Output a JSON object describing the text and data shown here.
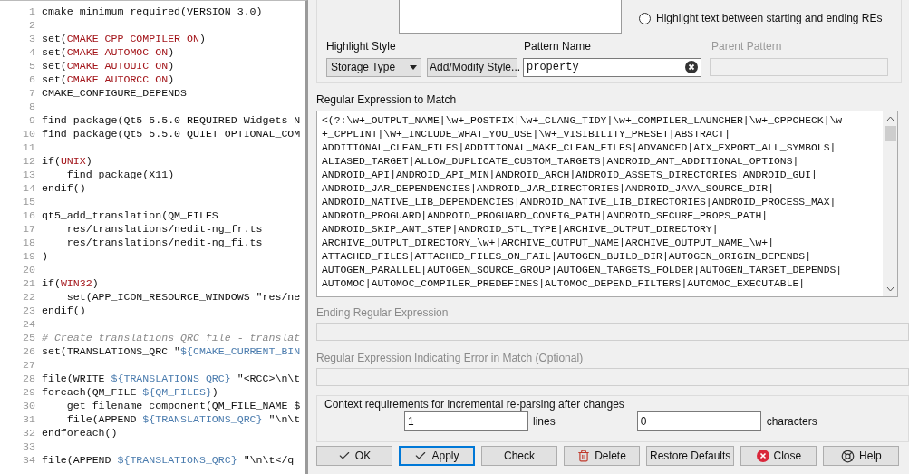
{
  "editor": {
    "lines": [
      {
        "number": "1",
        "segments": [
          {
            "kind": "plain",
            "text": "cmake minimum required(VERSION 3.0)"
          }
        ]
      },
      {
        "number": "2"
      },
      {
        "number": "3",
        "segments": [
          {
            "kind": "plain",
            "text": "set("
          },
          {
            "kind": "var",
            "text": "CMAKE CPP COMPILER ON"
          },
          {
            "kind": "plain",
            "text": ")"
          }
        ]
      },
      {
        "number": "4",
        "segments": [
          {
            "kind": "plain",
            "text": "set("
          },
          {
            "kind": "var",
            "text": "CMAKE AUTOMOC ON"
          },
          {
            "kind": "plain",
            "text": ")"
          }
        ]
      },
      {
        "number": "5",
        "segments": [
          {
            "kind": "plain",
            "text": "set("
          },
          {
            "kind": "var",
            "text": "CMAKE AUTOUIC ON"
          },
          {
            "kind": "plain",
            "text": ")"
          }
        ]
      },
      {
        "number": "6",
        "segments": [
          {
            "kind": "plain",
            "text": "set("
          },
          {
            "kind": "var",
            "text": "CMAKE AUTORCC ON"
          },
          {
            "kind": "plain",
            "text": ")"
          }
        ]
      },
      {
        "number": "7",
        "segments": [
          {
            "kind": "plain",
            "text": "CMAKE_CONFIGURE_DEPENDS"
          }
        ]
      },
      {
        "number": "8"
      },
      {
        "number": "9",
        "segments": [
          {
            "kind": "plain",
            "text": "find package(Qt5 5.5.0 REQUIRED Widgets N"
          }
        ]
      },
      {
        "number": "10",
        "segments": [
          {
            "kind": "plain",
            "text": "find package(Qt5 5.5.0 QUIET OPTIONAL_COM"
          }
        ]
      },
      {
        "number": "11"
      },
      {
        "number": "12",
        "segments": [
          {
            "kind": "plain",
            "text": "if("
          },
          {
            "kind": "var",
            "text": "UNIX"
          },
          {
            "kind": "plain",
            "text": ")"
          }
        ]
      },
      {
        "number": "13",
        "segments": [
          {
            "kind": "plain",
            "text": "    find package(X11)"
          }
        ]
      },
      {
        "number": "14",
        "segments": [
          {
            "kind": "plain",
            "text": "endif()"
          }
        ]
      },
      {
        "number": "15"
      },
      {
        "number": "16",
        "segments": [
          {
            "kind": "plain",
            "text": "qt5_add_translation(QM_FILES"
          }
        ]
      },
      {
        "number": "17",
        "segments": [
          {
            "kind": "plain",
            "text": "    res/translations/nedit-ng_fr.ts"
          }
        ]
      },
      {
        "number": "18",
        "segments": [
          {
            "kind": "plain",
            "text": "    res/translations/nedit-ng_fi.ts"
          }
        ]
      },
      {
        "number": "19",
        "segments": [
          {
            "kind": "plain",
            "text": ")"
          }
        ]
      },
      {
        "number": "20"
      },
      {
        "number": "21",
        "segments": [
          {
            "kind": "plain",
            "text": "if("
          },
          {
            "kind": "var",
            "text": "WIN32"
          },
          {
            "kind": "plain",
            "text": ")"
          }
        ]
      },
      {
        "number": "22",
        "segments": [
          {
            "kind": "plain",
            "text": "    set(APP_ICON_RESOURCE_WINDOWS \"res/ne"
          }
        ]
      },
      {
        "number": "23",
        "segments": [
          {
            "kind": "plain",
            "text": "endif()"
          }
        ]
      },
      {
        "number": "24"
      },
      {
        "number": "25",
        "segments": [
          {
            "kind": "comment",
            "text": "# Create translations QRC file - translat"
          }
        ]
      },
      {
        "number": "26",
        "segments": [
          {
            "kind": "plain",
            "text": "set(TRANSLATIONS_QRC \""
          },
          {
            "kind": "subst",
            "text": "${CMAKE_CURRENT_BIN"
          }
        ]
      },
      {
        "number": "27"
      },
      {
        "number": "28",
        "segments": [
          {
            "kind": "plain",
            "text": "file(WRITE "
          },
          {
            "kind": "subst",
            "text": "${TRANSLATIONS_QRC}"
          },
          {
            "kind": "plain",
            "text": " \"<RCC>\\n\\t"
          }
        ]
      },
      {
        "number": "29",
        "segments": [
          {
            "kind": "plain",
            "text": "foreach(QM_FILE "
          },
          {
            "kind": "subst",
            "text": "${QM_FILES}"
          },
          {
            "kind": "plain",
            "text": ")"
          }
        ]
      },
      {
        "number": "30",
        "segments": [
          {
            "kind": "plain",
            "text": "    get filename component(QM_FILE_NAME $"
          }
        ]
      },
      {
        "number": "31",
        "segments": [
          {
            "kind": "plain",
            "text": "    file(APPEND "
          },
          {
            "kind": "subst",
            "text": "${TRANSLATIONS_QRC}"
          },
          {
            "kind": "plain",
            "text": " \"\\n\\t"
          }
        ]
      },
      {
        "number": "32",
        "segments": [
          {
            "kind": "plain",
            "text": "endforeach()"
          }
        ]
      },
      {
        "number": "33"
      },
      {
        "number": "34",
        "segments": [
          {
            "kind": "plain",
            "text": "file(APPEND "
          },
          {
            "kind": "subst",
            "text": "${TRANSLATIONS_QRC}"
          },
          {
            "kind": "plain",
            "text": " \"\\n\\t</q"
          }
        ]
      }
    ]
  },
  "dialog": {
    "radio": {
      "label": "Highlight text between starting and ending REs",
      "selected": false
    },
    "highlight_style": {
      "label": "Highlight Style",
      "value": "Storage Type"
    },
    "add_modify_button": "Add/Modify Style...",
    "pattern_name": {
      "label": "Pattern Name",
      "value": "property"
    },
    "parent_pattern": {
      "label": "Parent Pattern",
      "disabled": true
    },
    "regex_to_match": {
      "label": "Regular Expression to Match",
      "lines": [
        "<(?:\\w+_OUTPUT_NAME|\\w+_POSTFIX|\\w+_CLANG_TIDY|\\w+_COMPILER_LAUNCHER|\\w+_CPPCHECK|\\w",
        "+_CPPLINT|\\w+_INCLUDE_WHAT_YOU_USE|\\w+_VISIBILITY_PRESET|ABSTRACT|",
        "ADDITIONAL_CLEAN_FILES|ADDITIONAL_MAKE_CLEAN_FILES|ADVANCED|AIX_EXPORT_ALL_SYMBOLS|",
        "ALIASED_TARGET|ALLOW_DUPLICATE_CUSTOM_TARGETS|ANDROID_ANT_ADDITIONAL_OPTIONS|",
        "ANDROID_API|ANDROID_API_MIN|ANDROID_ARCH|ANDROID_ASSETS_DIRECTORIES|ANDROID_GUI|",
        "ANDROID_JAR_DEPENDENCIES|ANDROID_JAR_DIRECTORIES|ANDROID_JAVA_SOURCE_DIR|",
        "ANDROID_NATIVE_LIB_DEPENDENCIES|ANDROID_NATIVE_LIB_DIRECTORIES|ANDROID_PROCESS_MAX|",
        "ANDROID_PROGUARD|ANDROID_PROGUARD_CONFIG_PATH|ANDROID_SECURE_PROPS_PATH|",
        "ANDROID_SKIP_ANT_STEP|ANDROID_STL_TYPE|ARCHIVE_OUTPUT_DIRECTORY|",
        "ARCHIVE_OUTPUT_DIRECTORY_\\w+|ARCHIVE_OUTPUT_NAME|ARCHIVE_OUTPUT_NAME_\\w+|",
        "ATTACHED_FILES|ATTACHED_FILES_ON_FAIL|AUTOGEN_BUILD_DIR|AUTOGEN_ORIGIN_DEPENDS|",
        "AUTOGEN_PARALLEL|AUTOGEN_SOURCE_GROUP|AUTOGEN_TARGETS_FOLDER|AUTOGEN_TARGET_DEPENDS|",
        "AUTOMOC|AUTOMOC_COMPILER_PREDEFINES|AUTOMOC_DEPEND_FILTERS|AUTOMOC_EXECUTABLE|"
      ]
    },
    "ending_regex": {
      "label": "Ending Regular Expression",
      "disabled": true
    },
    "error_regex": {
      "label": "Regular Expression Indicating Error in Match (Optional)",
      "disabled": true
    },
    "context": {
      "title": "Context requirements for incremental re-parsing after changes",
      "lines_value": "1",
      "lines_label": "lines",
      "chars_value": "0",
      "chars_label": "characters"
    },
    "buttons": [
      {
        "label": "OK",
        "kind": "confirm",
        "focused": false
      },
      {
        "label": "Apply",
        "kind": "confirm",
        "focused": true
      },
      {
        "label": "Check",
        "kind": "plain",
        "focused": false
      },
      {
        "label": "Delete",
        "kind": "delete",
        "focused": false
      },
      {
        "label": "Restore Defaults",
        "kind": "plain",
        "focused": false
      },
      {
        "label": "Close",
        "kind": "close",
        "focused": false
      },
      {
        "label": "Help",
        "kind": "help",
        "focused": false
      }
    ]
  }
}
